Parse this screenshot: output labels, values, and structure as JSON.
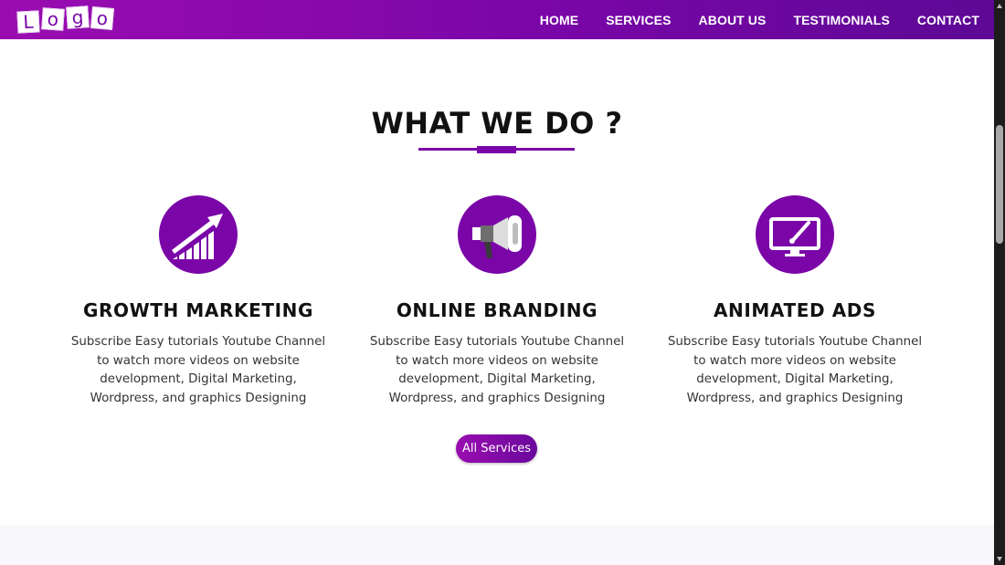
{
  "header": {
    "logo_letters": [
      "L",
      "o",
      "g",
      "o"
    ],
    "nav": [
      "HOME",
      "SERVICES",
      "ABOUT US",
      "TESTIMONIALS",
      "CONTACT"
    ]
  },
  "section": {
    "title": "WHAT WE DO ?",
    "services": [
      {
        "icon": "growth-chart-icon",
        "title": "GROWTH MARKETING",
        "description": "Subscribe Easy tutorials Youtube Channel to watch more videos on website development, Digital Marketing, Wordpress, and graphics Designing"
      },
      {
        "icon": "megaphone-icon",
        "title": "ONLINE BRANDING",
        "description": "Subscribe Easy tutorials Youtube Channel to watch more videos on website development, Digital Marketing, Wordpress, and graphics Designing"
      },
      {
        "icon": "monitor-design-icon",
        "title": "ANIMATED ADS",
        "description": "Subscribe Easy tutorials Youtube Channel to watch more videos on website development, Digital Marketing, Wordpress, and graphics Designing"
      }
    ],
    "button_label": "All Services"
  },
  "colors": {
    "brand_purple": "#7a06a8",
    "header_gradient_start": "#9a0cb0",
    "header_gradient_end": "#5d0895"
  }
}
